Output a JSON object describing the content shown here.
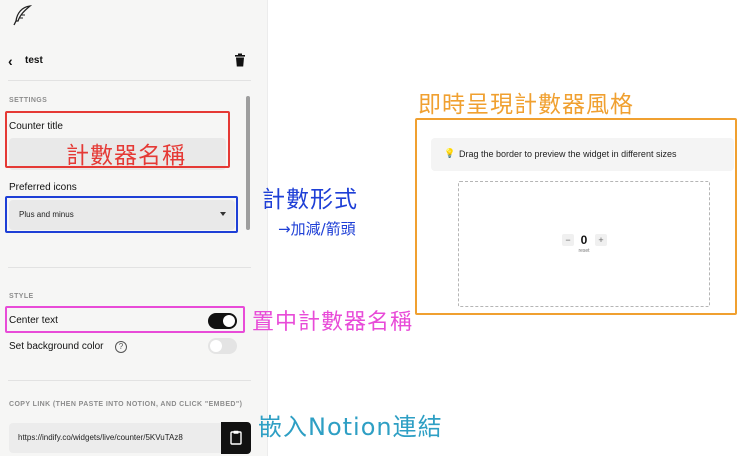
{
  "sidebar": {
    "widget_name": "test",
    "settings_section": "SETTINGS",
    "counter_title_label": "Counter title",
    "counter_title_value": "",
    "preferred_icons_label": "Preferred icons",
    "preferred_icons_value": "Plus and minus",
    "style_section": "STYLE",
    "center_text_label": "Center text",
    "center_text_enabled": true,
    "background_color_label": "Set background color",
    "background_color_enabled": false,
    "help_glyph": "?",
    "copy_link_section": "COPY LINK (THEN PASTE INTO NOTION, AND CLICK \"EMBED\")",
    "copy_link_value": "https://indify.co/widgets/live/counter/5KVuTAz8"
  },
  "preview": {
    "hint": "Drag the border to preview the widget in different sizes",
    "minus": "−",
    "plus": "+",
    "count": "0",
    "reset": "reset"
  },
  "annotations": {
    "title_note": "計數器名稱",
    "icons_note": "計數形式",
    "icons_subnote": "→加減/箭頭",
    "center_note": "置中計數器名稱",
    "preview_note": "即時呈現計數器風格",
    "link_note": "嵌入Notion連結"
  },
  "colors": {
    "red": "#e53935",
    "blue": "#1e3fd6",
    "pink": "#e84bd8",
    "orange": "#f0a030",
    "teal": "#2e9fc4",
    "toggle_on": "#111111"
  },
  "icons": [
    "feather-logo-icon",
    "back-chevron-icon",
    "trash-icon",
    "chevron-down-icon",
    "help-icon",
    "clipboard-icon",
    "lightbulb-icon"
  ]
}
